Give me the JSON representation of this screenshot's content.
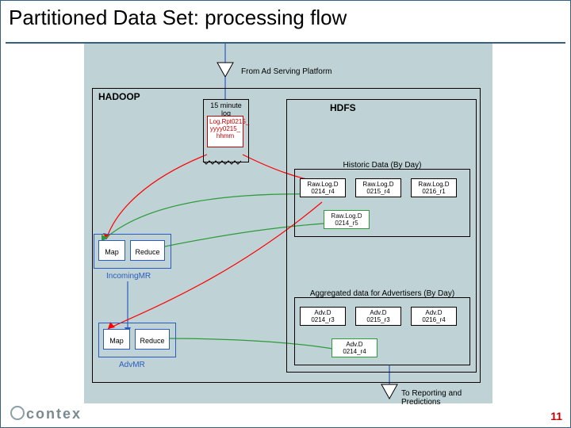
{
  "slide": {
    "title": "Partitioned Data Set: processing flow",
    "page_number": "11",
    "logo_text": "contex"
  },
  "top": {
    "from_platform": "From Ad Serving Platform"
  },
  "hadoop": {
    "label": "HADOOP",
    "log_box": "15 minute log",
    "log_file": "Log.Rpt0215_\nyyyy0215_\nhhmm",
    "incoming": {
      "map": "Map",
      "reduce": "Reduce",
      "label": "IncomingMR"
    },
    "adv": {
      "map": "Map",
      "reduce": "Reduce",
      "label": "AdvMR"
    }
  },
  "hdfs": {
    "label": "HDFS",
    "historic": {
      "title": "Historic Data (By Day)",
      "files": [
        "Raw.Log.D\n0214_r4",
        "Raw.Log.D\n0215_r4",
        "Raw.Log.D\n0216_r1"
      ],
      "moved": "Raw.Log.D\n0214_r5"
    },
    "aggregated": {
      "title": "Aggregated data for Advertisers (By Day)",
      "files": [
        "Adv.D\n0214_r3",
        "Adv.D\n0215_r3",
        "Adv.D\n0216_r4"
      ],
      "moved": "Adv.D\n0214_r4"
    }
  },
  "bottom": {
    "to_reporting": "To Reporting and Predictions"
  }
}
